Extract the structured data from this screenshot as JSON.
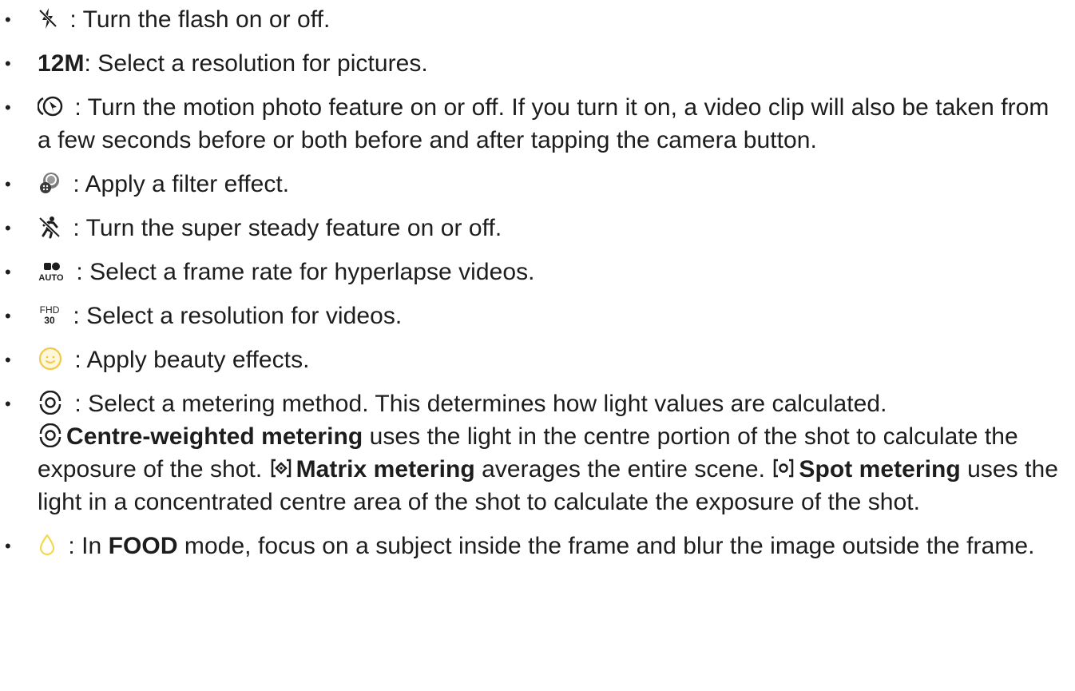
{
  "items": [
    {
      "icon": "flash-off-icon",
      "sep": " : ",
      "text": "Turn the flash on or off."
    },
    {
      "label": "12M",
      "sep": ": ",
      "text": "Select a resolution for pictures."
    },
    {
      "icon": "motion-photo-icon",
      "sep": " : ",
      "text": "Turn the motion photo feature on or off. If you turn it on, a video clip will also be taken from a few seconds before or both before and after tapping the camera button."
    },
    {
      "icon": "filter-icon",
      "sep": " : ",
      "text": "Apply a filter effect."
    },
    {
      "icon": "super-steady-icon",
      "sep": " : ",
      "text": "Turn the super steady feature on or off."
    },
    {
      "icon": "frame-rate-auto-icon",
      "icon_text": "AUTO",
      "sep": " : ",
      "text": "Select a frame rate for hyperlapse videos."
    },
    {
      "icon": "video-resolution-icon",
      "icon_text_top": "FHD",
      "icon_text_bottom": "30",
      "sep": " : ",
      "text": "Select a resolution for videos."
    },
    {
      "icon": "beauty-icon",
      "sep": " : ",
      "text": "Apply beauty effects."
    },
    {
      "icon": "metering-icon",
      "sep": " : ",
      "text": "Select a metering method. This determines how light values are calculated.",
      "centre_label": "Centre-weighted metering",
      "centre_text": " uses the light in the centre portion of the shot to calculate the exposure of the shot. ",
      "matrix_label": "Matrix metering",
      "matrix_text": " averages the entire scene. ",
      "spot_label": "Spot metering",
      "spot_text": " uses the light in a concentrated centre area of the shot to calculate the exposure of the shot."
    },
    {
      "icon": "food-focus-icon",
      "sep": " : ",
      "text_before": "In ",
      "mode_label": "FOOD",
      "text_after": " mode, focus on a subject inside the frame and blur the image outside the frame."
    }
  ],
  "bullet_char": "•",
  "colors": {
    "text": "#1d1d1d",
    "beauty_accent": "#f2c94c",
    "food_accent": "#f2d94c"
  }
}
